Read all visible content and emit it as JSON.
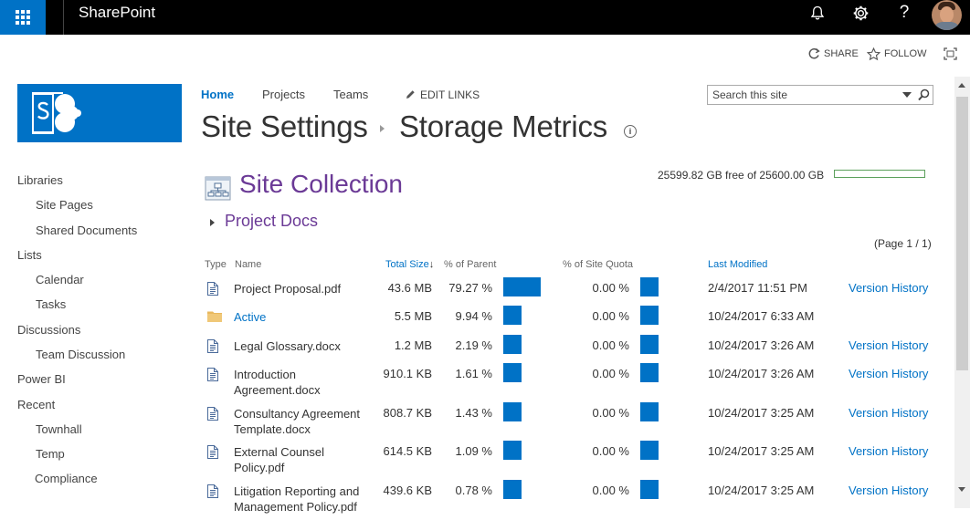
{
  "suitebar": {
    "brand": "SharePoint",
    "accent_color": "#0072c6",
    "icons": [
      "app-launcher-icon",
      "bell-icon",
      "gear-icon",
      "help-icon"
    ]
  },
  "actions": {
    "share": "SHARE",
    "follow": "FOLLOW"
  },
  "topnav": {
    "home": "Home",
    "projects": "Projects",
    "teams": "Teams",
    "edit_links": "EDIT LINKS"
  },
  "search": {
    "placeholder": "Search this site"
  },
  "page": {
    "title_part1": "Site Settings",
    "title_part2": "Storage Metrics",
    "info_icon": "i"
  },
  "leftnav": {
    "libraries": "Libraries",
    "site_pages": "Site Pages",
    "shared_documents": "Shared Documents",
    "lists": "Lists",
    "calendar": "Calendar",
    "tasks": "Tasks",
    "discussions": "Discussions",
    "team_discussion": "Team Discussion",
    "power_bi": "Power BI",
    "recent": "Recent",
    "townhall": "Townhall",
    "temp": "Temp",
    "compliance": "Compliance"
  },
  "storage": {
    "heading": "Site Collection",
    "quota_text": "25599.82 GB free of 25600.00 GB",
    "quota_used_fraction": 1e-05,
    "folder": "Project Docs",
    "paging": "(Page 1 / 1)"
  },
  "table": {
    "headers": {
      "type": "Type",
      "name": "Name",
      "total_size": "Total Size",
      "sort_indicator": "↓",
      "parent_pct": "% of Parent",
      "quota_pct": "% of Site Quota",
      "last_modified": "Last Modified"
    },
    "rows": [
      {
        "type_icon": "document-icon",
        "name": "Project Proposal.pdf",
        "size": "43.6 MB",
        "parent_pct": "79.27 %",
        "parent_fraction": 0.7927,
        "quota_pct": "0.00 %",
        "modified": "2/4/2017 11:51 PM",
        "version_history": "Version History"
      },
      {
        "type_icon": "folder-icon",
        "name": "Active",
        "size": "5.5 MB",
        "parent_pct": "9.94 %",
        "parent_fraction": 0.0994,
        "quota_pct": "0.00 %",
        "modified": "10/24/2017 6:33 AM",
        "version_history": ""
      },
      {
        "type_icon": "document-icon",
        "name": "Legal Glossary.docx",
        "size": "1.2 MB",
        "parent_pct": "2.19 %",
        "parent_fraction": 0.0219,
        "quota_pct": "0.00 %",
        "modified": "10/24/2017 3:26 AM",
        "version_history": "Version History"
      },
      {
        "type_icon": "document-icon",
        "name": "Introduction Agreement.docx",
        "size": "910.1 KB",
        "parent_pct": "1.61 %",
        "parent_fraction": 0.0161,
        "quota_pct": "0.00 %",
        "modified": "10/24/2017 3:26 AM",
        "version_history": "Version History"
      },
      {
        "type_icon": "document-icon",
        "name": "Consultancy Agreement Template.docx",
        "size": "808.7 KB",
        "parent_pct": "1.43 %",
        "parent_fraction": 0.0143,
        "quota_pct": "0.00 %",
        "modified": "10/24/2017 3:25 AM",
        "version_history": "Version History"
      },
      {
        "type_icon": "document-icon",
        "name": "External Counsel Policy.pdf",
        "size": "614.5 KB",
        "parent_pct": "1.09 %",
        "parent_fraction": 0.0109,
        "quota_pct": "0.00 %",
        "modified": "10/24/2017 3:25 AM",
        "version_history": "Version History"
      },
      {
        "type_icon": "document-icon",
        "name": "Litigation Reporting and Management Policy.pdf",
        "size": "439.6 KB",
        "parent_pct": "0.78 %",
        "parent_fraction": 0.0078,
        "quota_pct": "0.00 %",
        "modified": "10/24/2017 3:25 AM",
        "version_history": "Version History"
      }
    ]
  }
}
